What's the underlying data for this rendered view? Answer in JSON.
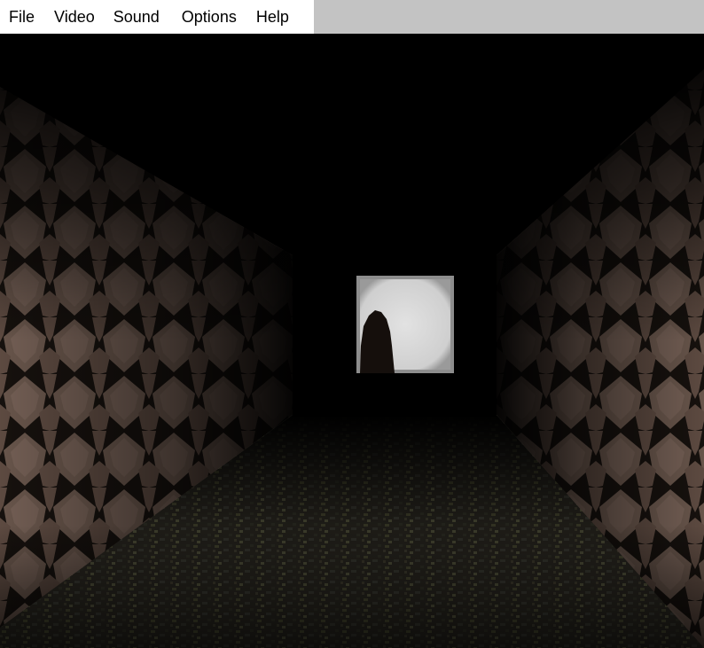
{
  "menu": {
    "items": [
      {
        "id": "file",
        "label": "File"
      },
      {
        "id": "video",
        "label": "Video"
      },
      {
        "id": "sound",
        "label": "Sound"
      },
      {
        "id": "options",
        "label": "Options"
      },
      {
        "id": "help",
        "label": "Help"
      }
    ]
  },
  "scene": {
    "colors": {
      "void": "#000000",
      "wall_stone": "#7a6458",
      "wall_mortar": "#1a1410",
      "floor_base": "#3e3a30",
      "floor_moss": "#6a6a48",
      "doorway_light": "#d6d6d6",
      "figure": "#150f0c"
    }
  }
}
